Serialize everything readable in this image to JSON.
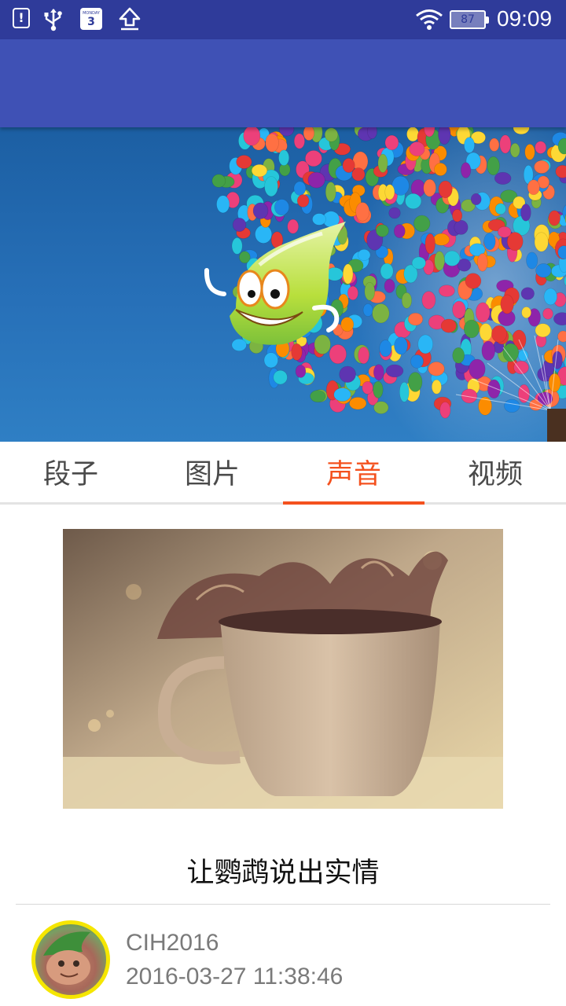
{
  "status_bar": {
    "alert_glyph": "!",
    "calendar_month": "MONDAY",
    "calendar_day": "3",
    "battery_level": "87",
    "time": "09:09",
    "icons": [
      "alert-icon",
      "usb-icon",
      "calendar-icon",
      "upload-icon",
      "wifi-icon",
      "battery-icon"
    ]
  },
  "app_bar": {
    "color": "#3f51b5"
  },
  "tabs": [
    {
      "label": "段子",
      "active": false
    },
    {
      "label": "图片",
      "active": false
    },
    {
      "label": "声音",
      "active": true
    },
    {
      "label": "视频",
      "active": false
    }
  ],
  "accent_color": "#f4511e",
  "post": {
    "title": "让鹦鹉说出实情",
    "author": "CIH2016",
    "timestamp": "2016-03-27 11:38:46"
  }
}
